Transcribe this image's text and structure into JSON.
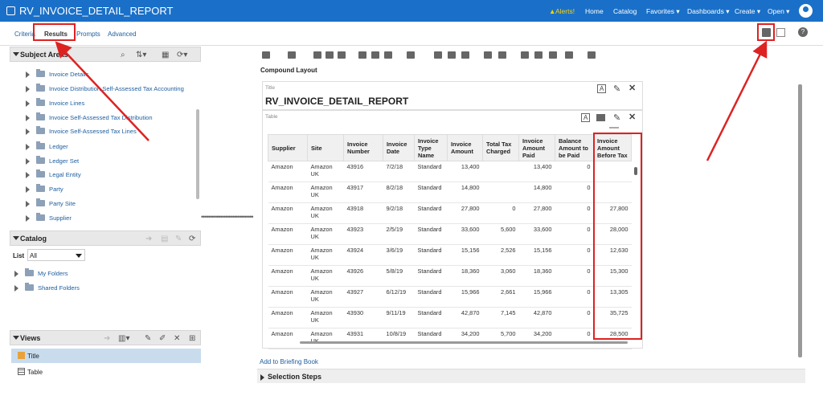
{
  "header": {
    "title": "RV_INVOICE_DETAIL_REPORT",
    "alerts": "Alerts!",
    "nav": [
      "Home",
      "Catalog",
      "Favorites ▾",
      "Dashboards ▾",
      "Create ▾",
      "Open ▾"
    ]
  },
  "tabs": [
    "Criteria",
    "Results",
    "Prompts",
    "Advanced"
  ],
  "subject_areas": {
    "title": "Subject Areas",
    "items": [
      "Invoice Details",
      "Invoice Distribution Self-Assessed Tax Accounting",
      "Invoice Lines",
      "Invoice Self-Assessed Tax Distribution",
      "Invoice Self-Assessed Tax Lines",
      "Ledger",
      "Ledger Set",
      "Legal Entity",
      "Party",
      "Party Site",
      "Supplier"
    ]
  },
  "catalog": {
    "title": "Catalog",
    "list_label": "List",
    "list_value": "All",
    "folders": [
      "My Folders",
      "Shared Folders"
    ]
  },
  "views": {
    "title": "Views",
    "items": [
      "Title",
      "Table"
    ]
  },
  "main": {
    "compound_layout": "Compound Layout",
    "title_view_label": "Title",
    "report_title": "RV_INVOICE_DETAIL_REPORT",
    "table_view_label": "Table",
    "add_briefing": "Add to Briefing Book",
    "selection_steps": "Selection Steps"
  },
  "table": {
    "columns": [
      "Supplier",
      "Site",
      "Invoice Number",
      "Invoice Date",
      "Invoice Type Name",
      "Invoice Amount",
      "Total Tax Charged",
      "Invoice Amount Paid",
      "Balance Amount to be Paid",
      "Invoice Amount Before Tax"
    ],
    "rows": [
      [
        "Amazon",
        "Amazon UK",
        "43916",
        "7/2/18",
        "Standard",
        "13,400",
        "",
        "13,400",
        "0",
        ""
      ],
      [
        "Amazon",
        "Amazon UK",
        "43917",
        "8/2/18",
        "Standard",
        "14,800",
        "",
        "14,800",
        "0",
        ""
      ],
      [
        "Amazon",
        "Amazon UK",
        "43918",
        "9/2/18",
        "Standard",
        "27,800",
        "0",
        "27,800",
        "0",
        "27,800"
      ],
      [
        "Amazon",
        "Amazon UK",
        "43923",
        "2/5/19",
        "Standard",
        "33,600",
        "5,600",
        "33,600",
        "0",
        "28,000"
      ],
      [
        "Amazon",
        "Amazon UK",
        "43924",
        "3/6/19",
        "Standard",
        "15,156",
        "2,526",
        "15,156",
        "0",
        "12,630"
      ],
      [
        "Amazon",
        "Amazon UK",
        "43926",
        "5/8/19",
        "Standard",
        "18,360",
        "3,060",
        "18,360",
        "0",
        "15,300"
      ],
      [
        "Amazon",
        "Amazon UK",
        "43927",
        "6/12/19",
        "Standard",
        "15,966",
        "2,661",
        "15,966",
        "0",
        "13,305"
      ],
      [
        "Amazon",
        "Amazon UK",
        "43930",
        "9/11/19",
        "Standard",
        "42,870",
        "7,145",
        "42,870",
        "0",
        "35,725"
      ],
      [
        "Amazon",
        "Amazon UK",
        "43931",
        "10/8/19",
        "Standard",
        "34,200",
        "5,700",
        "34,200",
        "0",
        "28,500"
      ]
    ]
  },
  "colors": {
    "header_bg": "#1a70c8",
    "highlight": "#dd2222",
    "link": "#1f5fa0"
  }
}
